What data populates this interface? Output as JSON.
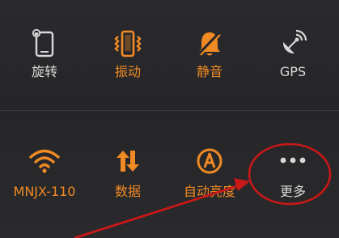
{
  "colors": {
    "accent": "#f08a24",
    "inactive": "#d8d8d8",
    "background": "#26262a",
    "annotation": "#c81818"
  },
  "toggles_row1": [
    {
      "label": "旋转",
      "icon": "rotation-lock-icon",
      "active": false
    },
    {
      "label": "振动",
      "icon": "vibrate-icon",
      "active": true
    },
    {
      "label": "静音",
      "icon": "mute-bell-icon",
      "active": true
    },
    {
      "label": "GPS",
      "icon": "gps-satellite-icon",
      "active": false
    }
  ],
  "toggles_row2": [
    {
      "label": "MNJX-110",
      "icon": "wifi-icon",
      "active": true
    },
    {
      "label": "数据",
      "icon": "mobile-data-icon",
      "active": true
    },
    {
      "label": "自动亮度",
      "icon": "auto-brightness-icon",
      "active": true
    },
    {
      "label": "更多",
      "icon": "more-dots-icon",
      "active": false
    }
  ]
}
